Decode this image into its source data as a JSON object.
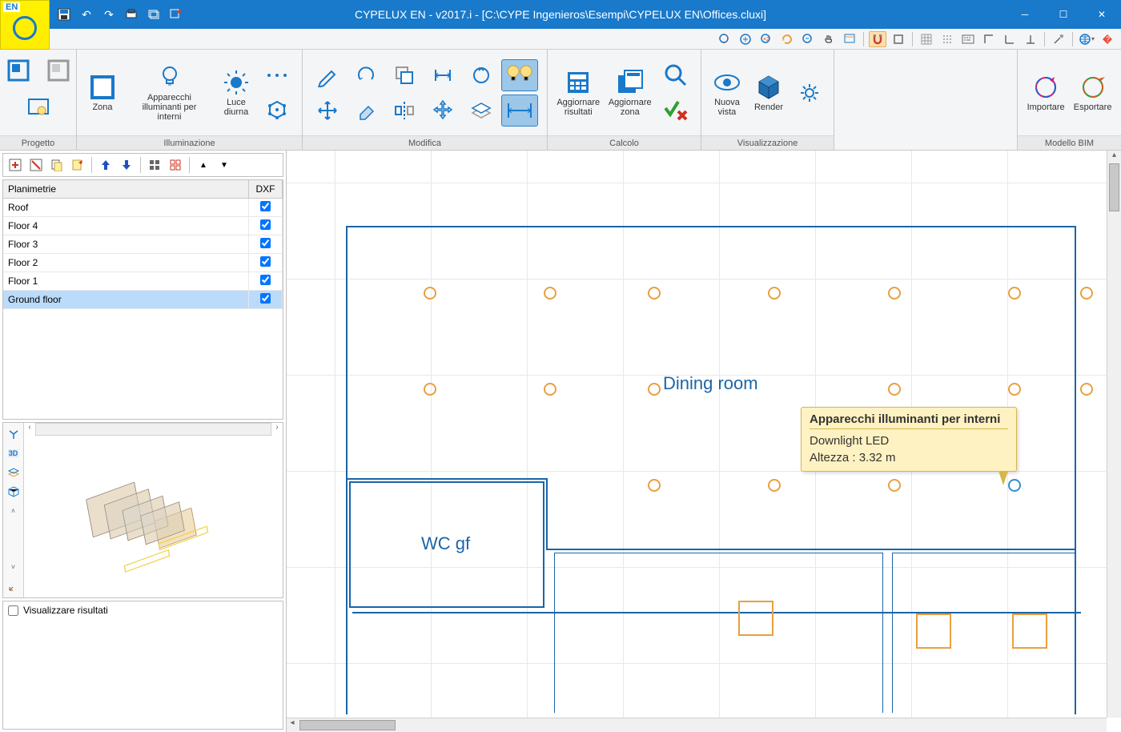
{
  "title": "CYPELUX EN - v2017.i - [C:\\CYPE Ingenieros\\Esempi\\CYPELUX EN\\Offices.cluxi]",
  "logo": {
    "lang": "EN"
  },
  "ribbon": {
    "progetto": {
      "label": "Progetto"
    },
    "illuminazione": {
      "label": "Illuminazione",
      "zona": "Zona",
      "apparecchi": "Apparecchi\nilluminanti per interni",
      "luce_diurna": "Luce\ndiurna"
    },
    "modifica": {
      "label": "Modifica"
    },
    "calcolo": {
      "label": "Calcolo",
      "aggiornare_risultati": "Aggiornare\nrisultati",
      "aggiornare_zona": "Aggiornare\nzona"
    },
    "visualizzazione": {
      "label": "Visualizzazione",
      "nuova_vista": "Nuova\nvista",
      "render": "Render"
    },
    "modello_bim": {
      "label": "Modello BIM",
      "importare": "Importare",
      "esportare": "Esportare"
    }
  },
  "sidepanel": {
    "table": {
      "col_planimetrie": "Planimetrie",
      "col_dxf": "DXF",
      "rows": [
        {
          "name": "Roof",
          "dxf": true,
          "selected": false
        },
        {
          "name": "Floor 4",
          "dxf": true,
          "selected": false
        },
        {
          "name": "Floor 3",
          "dxf": true,
          "selected": false
        },
        {
          "name": "Floor 2",
          "dxf": true,
          "selected": false
        },
        {
          "name": "Floor 1",
          "dxf": true,
          "selected": false
        },
        {
          "name": "Ground floor",
          "dxf": true,
          "selected": true
        }
      ]
    },
    "results": {
      "label": "Visualizzare risultati"
    }
  },
  "canvas": {
    "room1": "Dining room",
    "room2": "WC gf"
  },
  "tooltip": {
    "title": "Apparecchi illuminanti per interni",
    "line1": "Downlight LED",
    "line2": "Altezza : 3.32 m"
  }
}
